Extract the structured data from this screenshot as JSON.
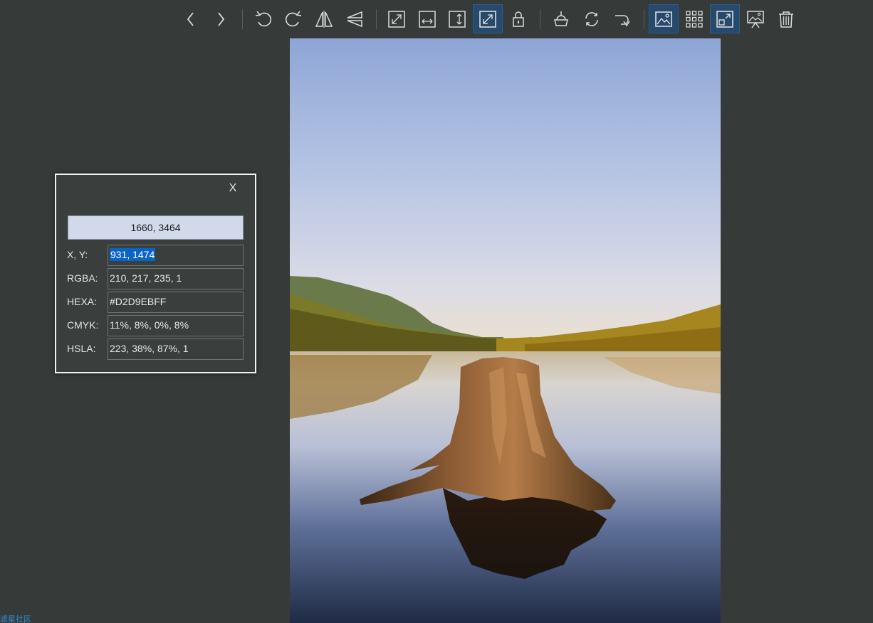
{
  "toolbar": {
    "buttons": [
      {
        "name": "previous-button",
        "icon": "chevron-left-icon",
        "active": false
      },
      {
        "name": "next-button",
        "icon": "chevron-right-icon",
        "active": false
      },
      {
        "name": "rotate-left-button",
        "icon": "rotate-ccw-icon",
        "active": false
      },
      {
        "name": "rotate-right-button",
        "icon": "rotate-cw-icon",
        "active": false
      },
      {
        "name": "flip-horizontal-button",
        "icon": "flip-horizontal-icon",
        "active": false
      },
      {
        "name": "flip-vertical-button",
        "icon": "flip-vertical-icon",
        "active": false
      },
      {
        "name": "original-size-button",
        "icon": "actual-size-icon",
        "active": false
      },
      {
        "name": "fit-width-button",
        "icon": "fit-width-icon",
        "active": false
      },
      {
        "name": "fit-height-button",
        "icon": "fit-height-icon",
        "active": false
      },
      {
        "name": "fit-window-button",
        "icon": "fit-window-icon",
        "active": true
      },
      {
        "name": "lock-zoom-button",
        "icon": "lock-icon",
        "active": false
      },
      {
        "name": "color-picker-button",
        "icon": "paint-bucket-icon",
        "active": false
      },
      {
        "name": "refresh-button",
        "icon": "refresh-icon",
        "active": false
      },
      {
        "name": "goto-button",
        "icon": "redo-arrow-icon",
        "active": false
      },
      {
        "name": "gallery-view-button",
        "icon": "image-icon",
        "active": true
      },
      {
        "name": "thumbnail-grid-button",
        "icon": "grid-icon",
        "active": false
      },
      {
        "name": "fullscreen-button",
        "icon": "fullscreen-icon",
        "active": true
      },
      {
        "name": "slideshow-button",
        "icon": "slideshow-icon",
        "active": false
      },
      {
        "name": "delete-button",
        "icon": "trash-icon",
        "active": false
      }
    ]
  },
  "picker": {
    "close_label": "X",
    "preview_text": "1660, 3464",
    "preview_color": "#d2d9eb",
    "rows": [
      {
        "label": "X, Y:",
        "value": "931, 1474"
      },
      {
        "label": "RGBA:",
        "value": "210, 217, 235, 1"
      },
      {
        "label": "HEXA:",
        "value": "#D2D9EBFF"
      },
      {
        "label": "CMYK:",
        "value": "11%, 8%, 0%, 8%"
      },
      {
        "label": "HSLA:",
        "value": "223, 38%, 87%, 1"
      }
    ]
  },
  "watermark": "滤星社区",
  "colors": {
    "background": "#363a39",
    "active_button": "#27496b",
    "selection": "#0a64c8"
  }
}
